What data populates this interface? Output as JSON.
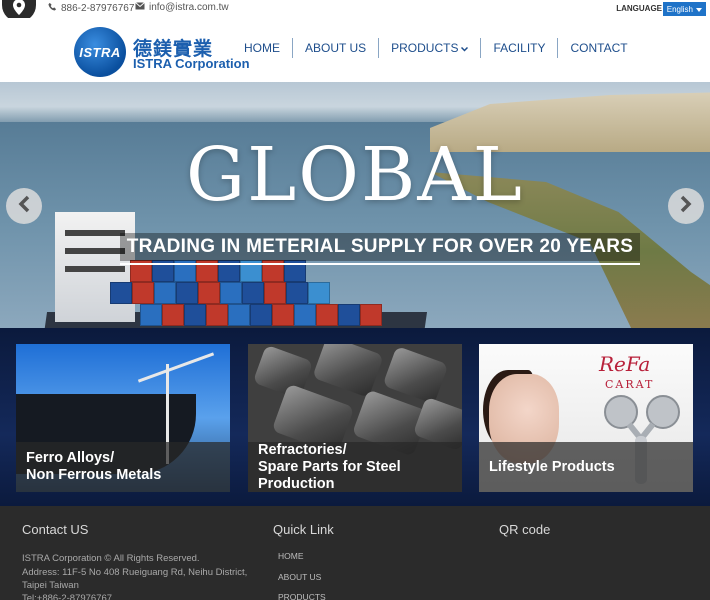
{
  "topbar": {
    "phone": "886-2-87976767",
    "email": "info@istra.com.tw",
    "language_label": "LANGUAGE",
    "language_value": "English"
  },
  "header": {
    "logo_badge": "ISTRA",
    "logo_zh": "德鎂實業",
    "logo_en": "ISTRA Corporation",
    "nav": [
      {
        "label": "HOME"
      },
      {
        "label": "ABOUT US"
      },
      {
        "label": "PRODUCTS"
      },
      {
        "label": "FACILITY"
      },
      {
        "label": "CONTACT"
      }
    ]
  },
  "hero": {
    "title": "GLOBAL",
    "subtitle": "TRADING IN METERIAL SUPPLY FOR OVER 20 YEARS"
  },
  "products": [
    {
      "line1": "Ferro Alloys/",
      "line2": "Non Ferrous Metals"
    },
    {
      "line1": "Refractories/",
      "line2": "Spare Parts for Steel Production"
    },
    {
      "line1": "Lifestyle Products",
      "line2": ""
    }
  ],
  "product_art": {
    "brand": "ReFa",
    "sub": "CARAT"
  },
  "footer": {
    "contact_heading": "Contact US",
    "copyright": "ISTRA Corporation © All Rights Reserved.",
    "address_line1": "Address: 11F-5 No 408 Rueiguang Rd, Neihu District,",
    "address_line2": "Taipei Taiwan",
    "tel": "Tel:+886-2-87976767",
    "quicklink_heading": "Quick Link",
    "links": [
      "HOME",
      "ABOUT US",
      "PRODUCTS"
    ],
    "qr_heading": "QR code"
  },
  "colors": {
    "brand_blue": "#1c5fae",
    "nav_text": "#1e4e8c",
    "language_select": "#1f73c8",
    "products_band": "#0b1a3d",
    "footer_bg": "#2b2b2b"
  }
}
